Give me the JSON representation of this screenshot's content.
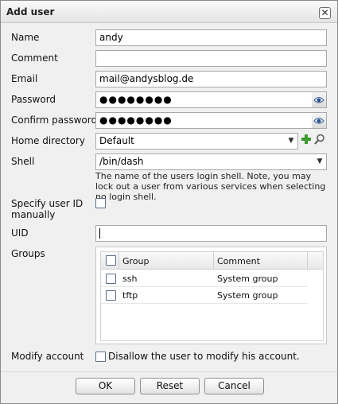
{
  "window": {
    "title": "Add user",
    "close_label": "✕"
  },
  "form": {
    "name": {
      "label": "Name",
      "value": "andy"
    },
    "comment": {
      "label": "Comment",
      "value": ""
    },
    "email": {
      "label": "Email",
      "value": "mail@andysblog.de"
    },
    "password": {
      "label": "Password",
      "value": "●●●●●●●●"
    },
    "confirm_password": {
      "label": "Confirm password",
      "value": "●●●●●●●●"
    },
    "home_directory": {
      "label": "Home directory",
      "value": "Default"
    },
    "shell": {
      "label": "Shell",
      "value": "/bin/dash",
      "hint": "The name of the users login shell. Note, you may lock out a user from various services when selecting no login shell."
    },
    "specify_uid": {
      "label_line1": "Specify user ID",
      "label_line2": "manually",
      "checked": false
    },
    "uid": {
      "label": "UID",
      "value": ""
    },
    "groups": {
      "label": "Groups",
      "columns": [
        "Group",
        "Comment"
      ],
      "rows": [
        {
          "group": "ssh",
          "comment": "System group",
          "checked": false
        },
        {
          "group": "tftp",
          "comment": "System group",
          "checked": false
        }
      ]
    },
    "modify_account": {
      "label": "Modify account",
      "checkbox_label": "Disallow the user to modify his account.",
      "checked": false
    }
  },
  "buttons": {
    "ok": "OK",
    "reset": "Reset",
    "cancel": "Cancel"
  },
  "icons": {
    "reveal_password": "eye-icon",
    "add_directory": "green-plus-icon",
    "browse_directory": "magnifier-icon",
    "dropdown": "chevron-down-icon"
  }
}
